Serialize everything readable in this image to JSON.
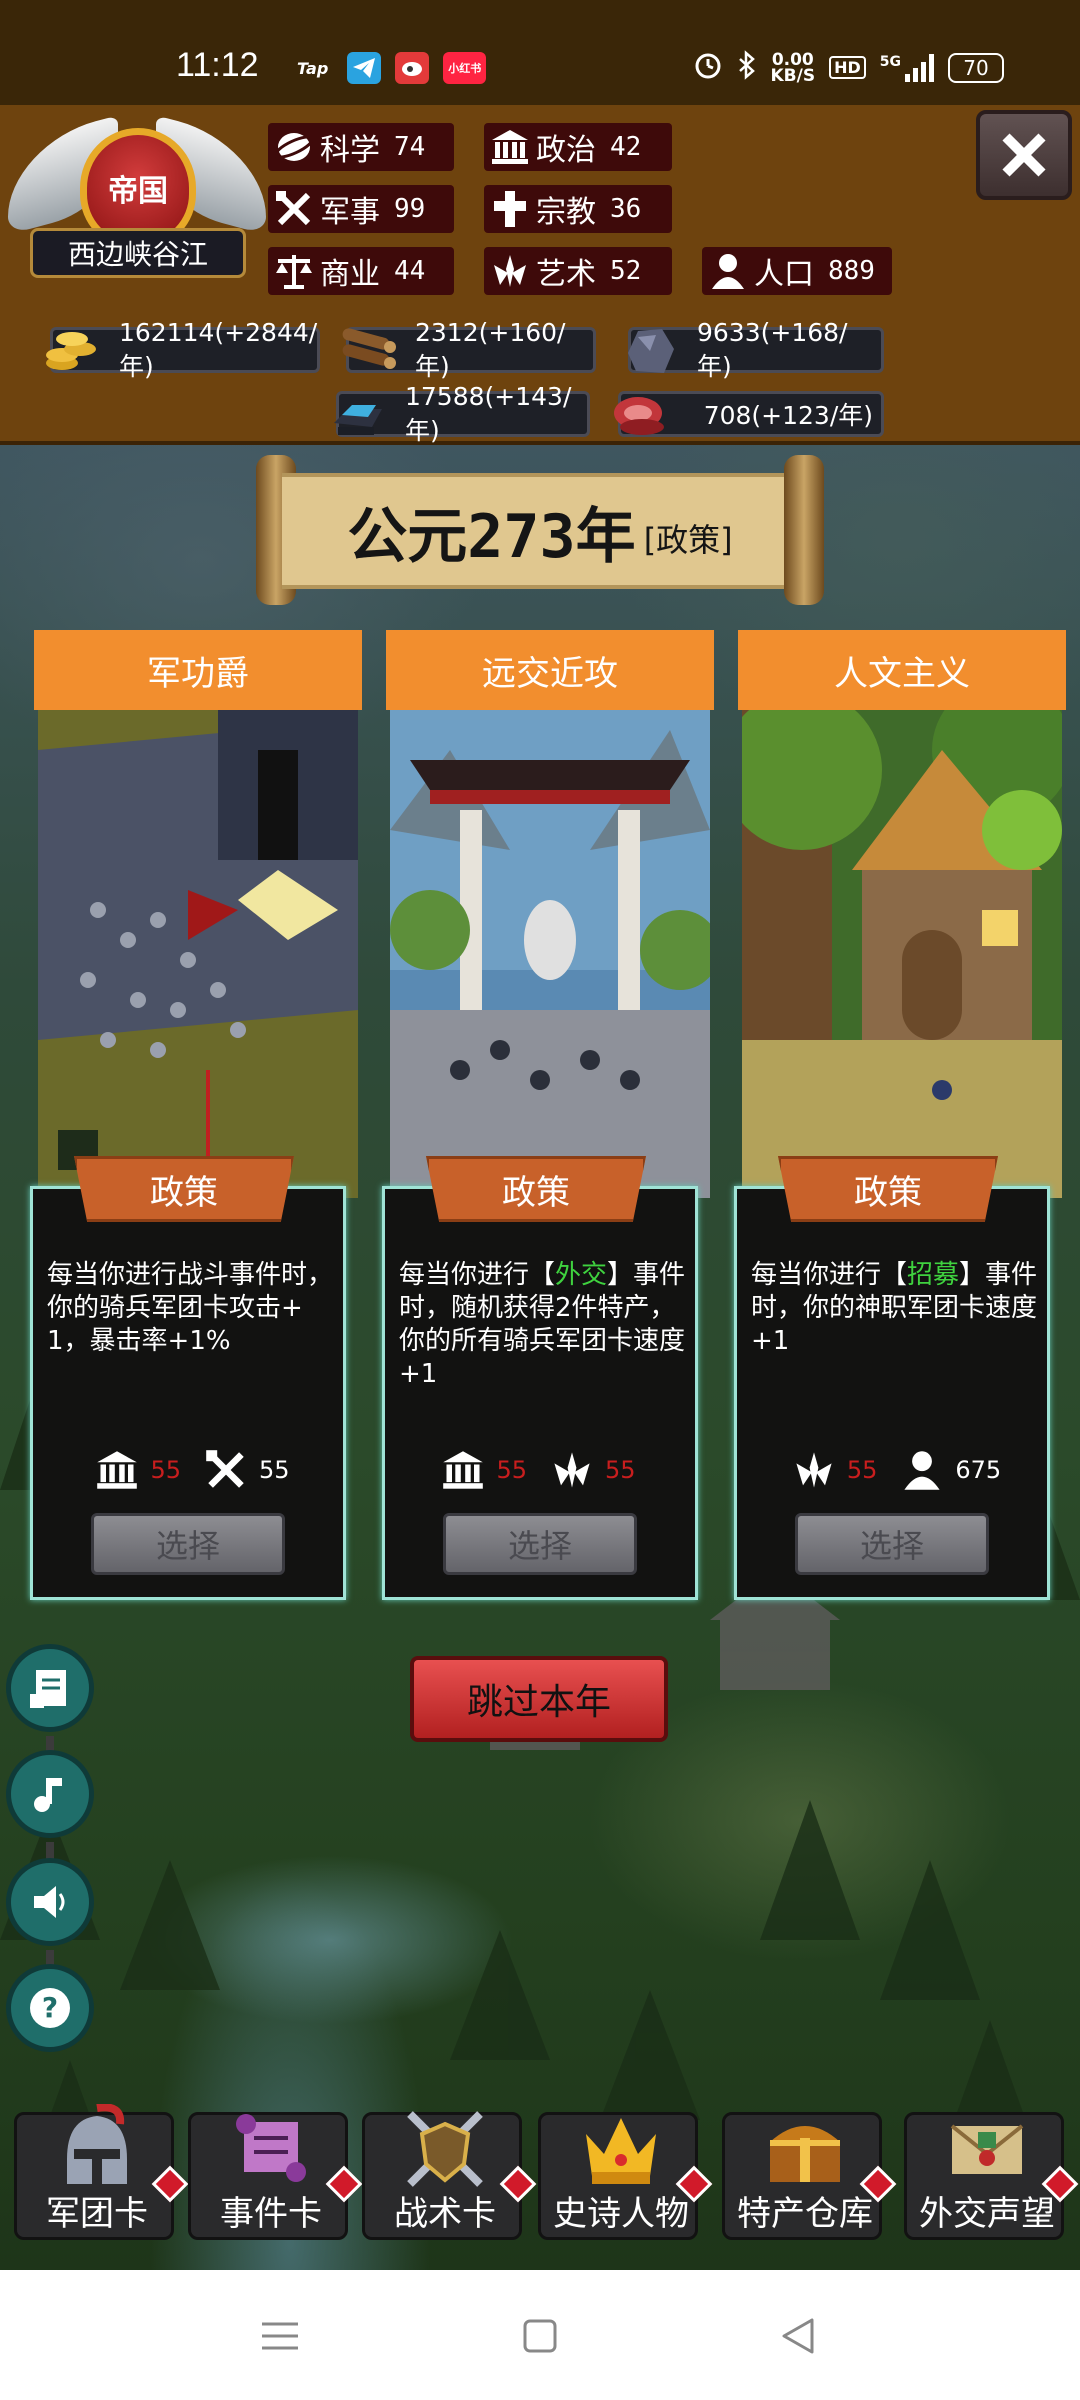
{
  "status_bar": {
    "time": "11:12",
    "apps": [
      "Tap",
      "telegram-icon",
      "weibo-icon",
      "小红书"
    ],
    "net_speed_value": "0.00",
    "net_speed_unit": "KB/S",
    "hd": "HD",
    "signal_label": "5G",
    "battery": "70"
  },
  "empire": {
    "badge": "帝国",
    "region": "西边峡谷江"
  },
  "stats": [
    {
      "label": "科学",
      "value": "74",
      "icon": "science-icon"
    },
    {
      "label": "政治",
      "value": "42",
      "icon": "politics-icon"
    },
    {
      "label": "军事",
      "value": "99",
      "icon": "military-icon"
    },
    {
      "label": "宗教",
      "value": "36",
      "icon": "religion-icon"
    },
    {
      "label": "商业",
      "value": "44",
      "icon": "commerce-icon"
    },
    {
      "label": "艺术",
      "value": "52",
      "icon": "art-icon"
    },
    {
      "label": "人口",
      "value": "889",
      "icon": "population-icon"
    }
  ],
  "resources": [
    {
      "value": "162114(+2844/年)",
      "icon": "gold-coins-icon"
    },
    {
      "value": "2312(+160/年)",
      "icon": "wood-logs-icon"
    },
    {
      "value": "9633(+168/年)",
      "icon": "stone-ore-icon"
    },
    {
      "value": "17588(+143/年)",
      "icon": "iron-ingot-icon"
    },
    {
      "value": "708(+123/年)",
      "icon": "meat-icon"
    }
  ],
  "year_banner": {
    "year": "公元273年",
    "mode": "[政策]"
  },
  "policy_tag_label": "政策",
  "choose_label": "选择",
  "cards": [
    {
      "title": "军功爵",
      "desc_parts": [
        "每当你进行战斗事件时，你的骑兵军团卡攻击+1，暴击率+1%"
      ],
      "costs": [
        {
          "icon": "politics-icon",
          "value": "55",
          "color": "red"
        },
        {
          "icon": "military-icon",
          "value": "55",
          "color": "white"
        }
      ]
    },
    {
      "title": "远交近攻",
      "desc_parts": [
        "每当你进行【",
        "外交",
        "】事件时，随机获得2件特产，你的所有骑兵军团卡速度+1"
      ],
      "costs": [
        {
          "icon": "politics-icon",
          "value": "55",
          "color": "red"
        },
        {
          "icon": "art-icon",
          "value": "55",
          "color": "red"
        }
      ]
    },
    {
      "title": "人文主义",
      "desc_parts": [
        "每当你进行【",
        "招募",
        "】事件时，你的神职军团卡速度+1"
      ],
      "costs": [
        {
          "icon": "art-icon",
          "value": "55",
          "color": "red"
        },
        {
          "icon": "population-icon",
          "value": "675",
          "color": "white"
        }
      ]
    }
  ],
  "skip_button": "跳过本年",
  "side_buttons": [
    "log-book-icon",
    "music-note-icon",
    "speaker-icon",
    "help-question-icon"
  ],
  "tabs": [
    {
      "label": "军团卡",
      "icon": "helmet-icon"
    },
    {
      "label": "事件卡",
      "icon": "scroll-icon"
    },
    {
      "label": "战术卡",
      "icon": "shield-swords-icon"
    },
    {
      "label": "史诗人物",
      "icon": "crown-icon"
    },
    {
      "label": "特产仓库",
      "icon": "treasure-chest-icon"
    },
    {
      "label": "外交声望",
      "icon": "envelope-icon"
    }
  ],
  "colors": {
    "hud_brown": "#6e430e",
    "stat_bg": "#3e0a0a",
    "card_orange": "#f28e2e",
    "policy_tag": "#c8612a",
    "card_border": "#9fe3d6",
    "highlight_green": "#3fd23f",
    "cost_red": "#c81e1e",
    "skip_red": "#d83434",
    "side_teal": "#1f6e6a"
  }
}
